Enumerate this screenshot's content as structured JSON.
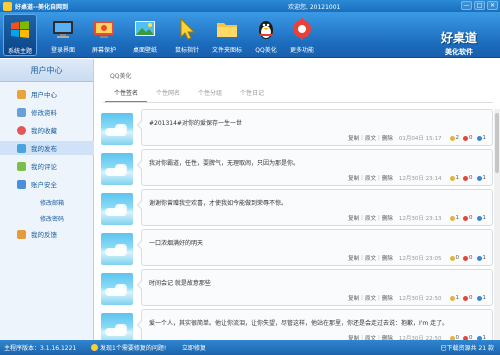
{
  "window": {
    "title": "好桌道--美化自网到",
    "welcome": "欢迎您, 20121001",
    "controls": [
      "—",
      "□",
      "✕"
    ]
  },
  "toolbar": {
    "items": [
      {
        "label": "系统主题",
        "icon": "windows-theme-icon"
      },
      {
        "label": "登录界面",
        "icon": "login-screen-icon"
      },
      {
        "label": "屏幕保护",
        "icon": "screensaver-icon"
      },
      {
        "label": "桌面壁纸",
        "icon": "wallpaper-icon"
      },
      {
        "label": "鼠标指针",
        "icon": "mouse-pointer-icon"
      },
      {
        "label": "文件夹图标",
        "icon": "folder-icon"
      },
      {
        "label": "QQ美化",
        "icon": "qq-penguin-icon"
      },
      {
        "label": "更多功能",
        "icon": "more-tools-icon"
      }
    ],
    "brand_line1": "好桌道",
    "brand_line2": "美化软件"
  },
  "sidebar": {
    "header": "用户中心",
    "items": [
      {
        "label": "用户中心",
        "icon": "home-icon",
        "color": "#e8a33a"
      },
      {
        "label": "修改资料",
        "icon": "edit-icon",
        "color": "#6a9fd8"
      },
      {
        "label": "我的收藏",
        "icon": "favorite-icon",
        "color": "#e2585a"
      },
      {
        "label": "我的发布",
        "icon": "publish-icon",
        "color": "#4aa3df"
      },
      {
        "label": "我的评论",
        "icon": "comment-icon",
        "color": "#7bbf4a"
      },
      {
        "label": "账户安全",
        "icon": "shield-icon",
        "color": "#4a8fd9"
      }
    ],
    "subitems": [
      "修改邮箱",
      "修改密码"
    ],
    "last_item": {
      "label": "我的反馈",
      "icon": "feedback-icon",
      "color": "#e59a3c"
    }
  },
  "main": {
    "crumb": "QQ美化",
    "tabs": [
      "个性签名",
      "个性网名",
      "个性分组",
      "个性日记"
    ],
    "active_tab": 0
  },
  "entries": [
    {
      "text": "#201314#对你的爱保存一生一世",
      "date": "01月04日 15:17",
      "gold": "2",
      "red": "0",
      "blue": "1"
    },
    {
      "text": "我对你霸道，任性，耍脾气，无理取闹，只因为那是你。",
      "date": "12月30日 23:14",
      "gold": "1",
      "red": "0",
      "blue": "1"
    },
    {
      "text": "谢谢你曾赠我空欢喜，才使我如今能做到荣辱不惊。",
      "date": "12月30日 23:13",
      "gold": "1",
      "red": "0",
      "blue": "1"
    },
    {
      "text": "一口浓烟满好的明天",
      "date": "12月30日 23:05",
      "gold": "0",
      "red": "0",
      "blue": "1"
    },
    {
      "text": "时间会记 就是故意那些",
      "date": "12月30日 22:50",
      "gold": "1",
      "red": "0",
      "blue": "1"
    },
    {
      "text": "爱一个人，其实很简单。他让你流泪，让你失望，尽管这样，他站在那里，你还是会走过去说：抱歉，I'm 走了。",
      "date": "12月30日 22:50",
      "gold": "0",
      "red": "0",
      "blue": "1"
    }
  ],
  "entry_actions": [
    "复制",
    "原文",
    "删除"
  ],
  "status": {
    "version": "主程序版本：3.1.16.1221",
    "warning": "发现1个需要修复的问题!",
    "fix": "立即修复",
    "downloads": "已下载资源共 21 款"
  }
}
